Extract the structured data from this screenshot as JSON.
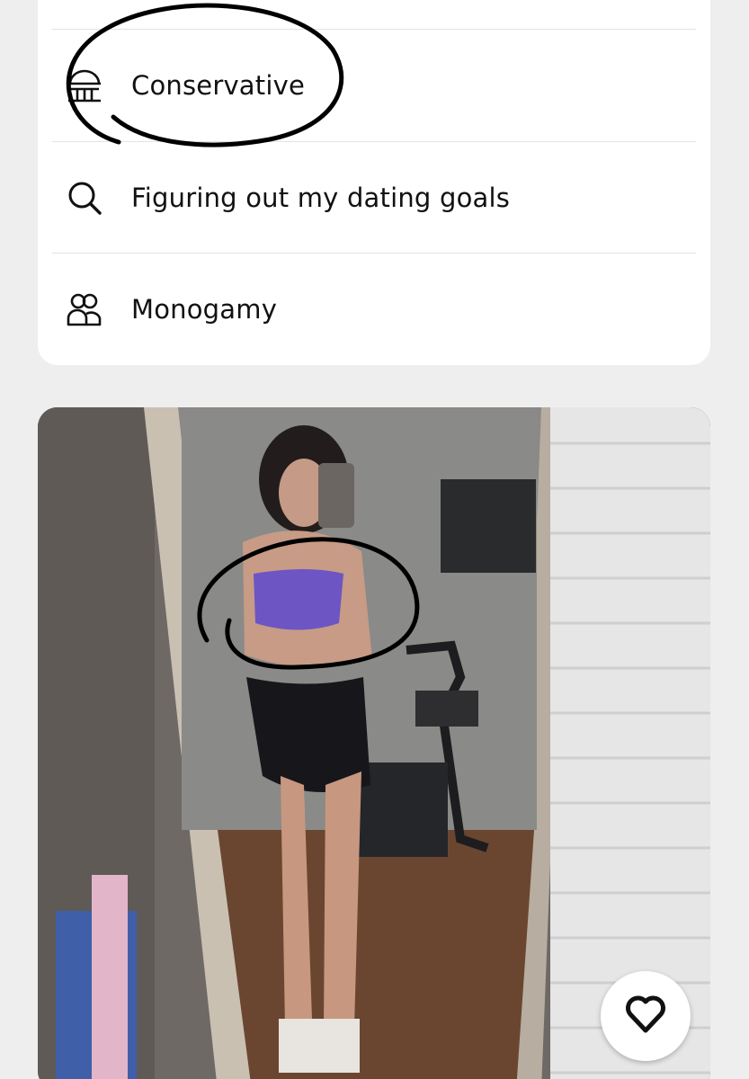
{
  "profile": {
    "details": [
      {
        "icon": "politics-icon",
        "label": "Conservative"
      },
      {
        "icon": "search-icon",
        "label": "Figuring out my dating goals"
      },
      {
        "icon": "relationship-type-icon",
        "label": "Monogamy"
      }
    ]
  },
  "photo": {
    "alt_icon": "photo"
  },
  "like": {
    "icon": "heart-icon"
  },
  "colors": {
    "background": "#efeeee",
    "card": "#ffffff",
    "text": "#111111",
    "divider": "#e4e3e3",
    "annotation": "#000000"
  }
}
